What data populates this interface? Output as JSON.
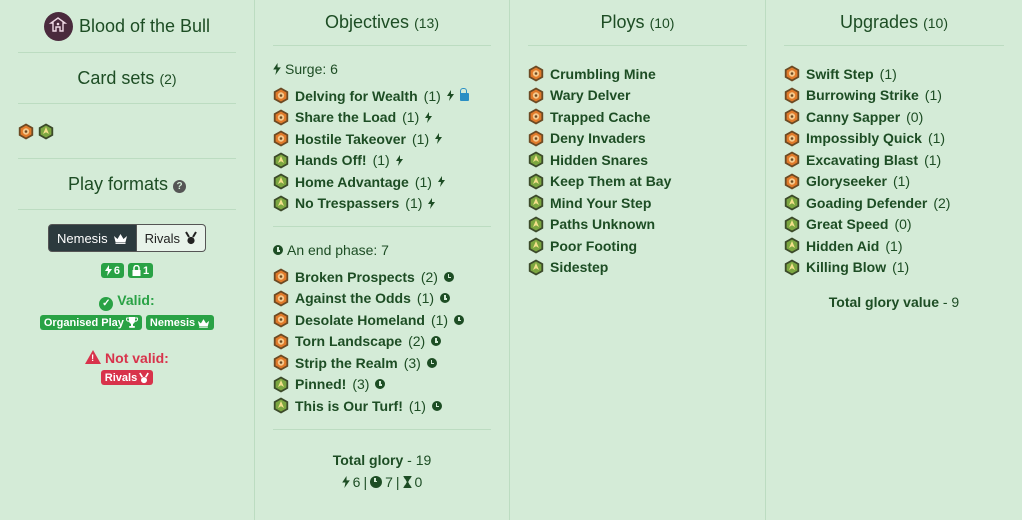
{
  "sidebar": {
    "warband_title": "Blood of the Bull",
    "card_sets_label": "Card sets",
    "card_sets_count": "(2)",
    "play_formats_label": "Play formats",
    "toggle": {
      "nemesis": "Nemesis",
      "rivals": "Rivals"
    },
    "surge_badge": "6",
    "lock_badge": "1",
    "valid_label": "Valid:",
    "valid_formats": [
      "Organised Play",
      "Nemesis"
    ],
    "not_valid_label": "Not valid:",
    "not_valid_formats": [
      "Rivals"
    ]
  },
  "objectives": {
    "title": "Objectives",
    "count": "(13)",
    "surge_label": "Surge: 6",
    "surge_cards": [
      {
        "name": "Delving for Wealth",
        "glory": "(1)",
        "set": "orange",
        "lock": true
      },
      {
        "name": "Share the Load",
        "glory": "(1)",
        "set": "orange",
        "lock": false
      },
      {
        "name": "Hostile Takeover",
        "glory": "(1)",
        "set": "orange",
        "lock": false
      },
      {
        "name": "Hands Off!",
        "glory": "(1)",
        "set": "green",
        "lock": false
      },
      {
        "name": "Home Advantage",
        "glory": "(1)",
        "set": "green",
        "lock": false
      },
      {
        "name": "No Trespassers",
        "glory": "(1)",
        "set": "green",
        "lock": false
      }
    ],
    "end_label": "An end phase: 7",
    "end_cards": [
      {
        "name": "Broken Prospects",
        "glory": "(2)",
        "set": "orange"
      },
      {
        "name": "Against the Odds",
        "glory": "(1)",
        "set": "orange"
      },
      {
        "name": "Desolate Homeland",
        "glory": "(1)",
        "set": "orange"
      },
      {
        "name": "Torn Landscape",
        "glory": "(2)",
        "set": "orange"
      },
      {
        "name": "Strip the Realm",
        "glory": "(3)",
        "set": "orange"
      },
      {
        "name": "Pinned!",
        "glory": "(3)",
        "set": "green"
      },
      {
        "name": "This is Our Turf!",
        "glory": "(1)",
        "set": "green"
      }
    ],
    "total_label": "Total glory",
    "total_value": "- 19",
    "surge_total": "6",
    "end_total": "7",
    "third_total": "0",
    "sep": "|"
  },
  "ploys": {
    "title": "Ploys",
    "count": "(10)",
    "cards": [
      {
        "name": "Crumbling Mine",
        "set": "orange"
      },
      {
        "name": "Wary Delver",
        "set": "orange"
      },
      {
        "name": "Trapped Cache",
        "set": "orange"
      },
      {
        "name": "Deny Invaders",
        "set": "orange"
      },
      {
        "name": "Hidden Snares",
        "set": "green"
      },
      {
        "name": "Keep Them at Bay",
        "set": "green"
      },
      {
        "name": "Mind Your Step",
        "set": "green"
      },
      {
        "name": "Paths Unknown",
        "set": "green"
      },
      {
        "name": "Poor Footing",
        "set": "green"
      },
      {
        "name": "Sidestep",
        "set": "green"
      }
    ]
  },
  "upgrades": {
    "title": "Upgrades",
    "count": "(10)",
    "cards": [
      {
        "name": "Swift Step",
        "glory": "(1)",
        "set": "orange"
      },
      {
        "name": "Burrowing Strike",
        "glory": "(1)",
        "set": "orange"
      },
      {
        "name": "Canny Sapper",
        "glory": "(0)",
        "set": "orange"
      },
      {
        "name": "Impossibly Quick",
        "glory": "(1)",
        "set": "orange"
      },
      {
        "name": "Excavating Blast",
        "glory": "(1)",
        "set": "orange"
      },
      {
        "name": "Gloryseeker",
        "glory": "(1)",
        "set": "orange"
      },
      {
        "name": "Goading Defender",
        "glory": "(2)",
        "set": "green"
      },
      {
        "name": "Great Speed",
        "glory": "(0)",
        "set": "green"
      },
      {
        "name": "Hidden Aid",
        "glory": "(1)",
        "set": "green"
      },
      {
        "name": "Killing Blow",
        "glory": "(1)",
        "set": "green"
      }
    ],
    "total_label": "Total glory value",
    "total_value": "- 9"
  },
  "colors": {
    "background": "#d4ebd7",
    "text": "#1d4d24",
    "valid": "#29a245",
    "invalid": "#d8334b",
    "set_orange": "#e07a2a",
    "set_green": "#7ca640"
  }
}
